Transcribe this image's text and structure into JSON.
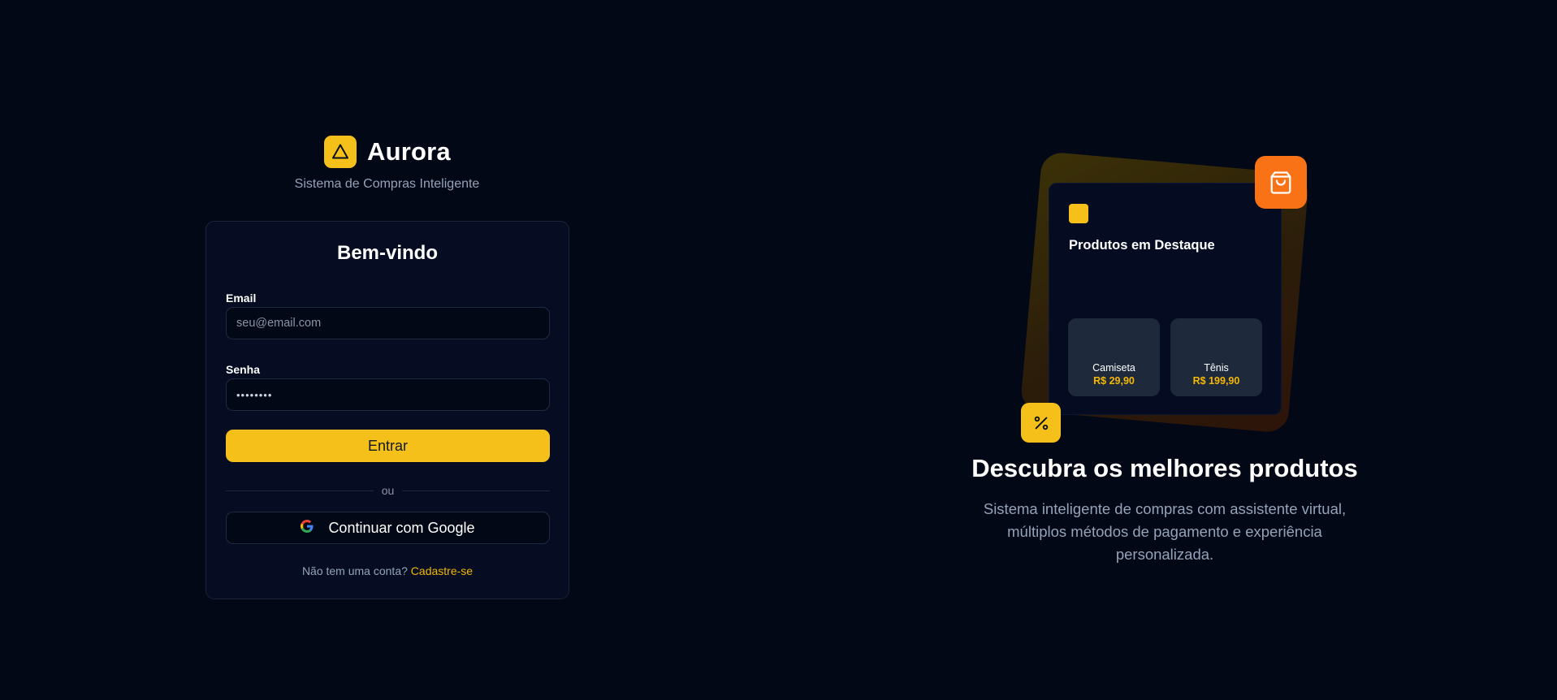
{
  "brand": {
    "name": "Aurora",
    "tagline": "Sistema de Compras Inteligente",
    "logo_icon": "triangle-icon"
  },
  "login": {
    "title": "Bem-vindo",
    "email": {
      "label": "Email",
      "placeholder": "seu@email.com",
      "value": ""
    },
    "password": {
      "label": "Senha",
      "value": "••••••••"
    },
    "submit_label": "Entrar",
    "divider_text": "ou",
    "google_label": "Continuar com Google",
    "signup_prompt": "Não tem uma conta?",
    "signup_link": "Cadastre-se"
  },
  "showcase": {
    "card_title": "Produtos em Destaque",
    "products": [
      {
        "name": "Camiseta",
        "price": "R$ 29,90"
      },
      {
        "name": "Tênis",
        "price": "R$ 199,90"
      }
    ],
    "bag_icon": "shopping-bag-icon",
    "discount_icon": "percent-icon",
    "headline": "Descubra os melhores produtos",
    "description": "Sistema inteligente de compras com assistente virtual, múltiplos métodos de pagamento e experiência personalizada."
  },
  "colors": {
    "background": "#030816",
    "accent": "#f5c01a",
    "orange": "#f97316",
    "card": "#060d22",
    "muted_text": "#94a3b8"
  }
}
